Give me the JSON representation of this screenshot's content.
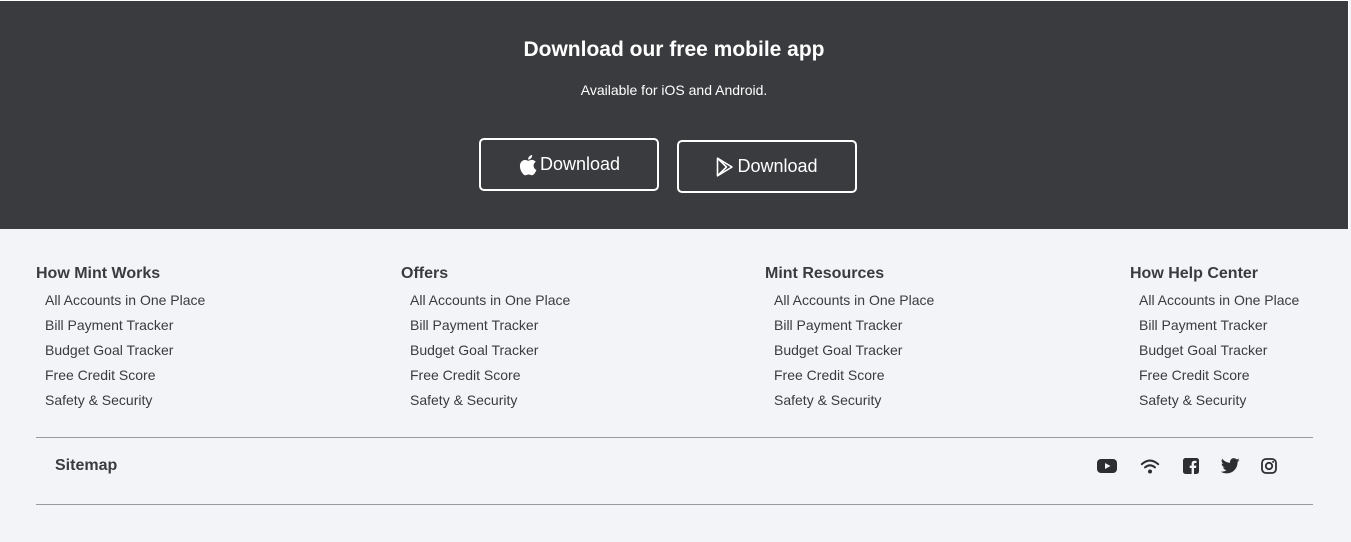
{
  "banner": {
    "title": "Download our free mobile app",
    "subtitle": "Available for iOS and Android.",
    "ios_label": "Download",
    "android_label": "Download"
  },
  "footer": {
    "columns": [
      {
        "title": "How Mint Works",
        "links": [
          "All Accounts in One Place",
          "Bill Payment Tracker",
          "Budget Goal Tracker",
          "Free Credit Score",
          "Safety & Security"
        ]
      },
      {
        "title": "Offers",
        "links": [
          "All Accounts in One Place",
          "Bill Payment Tracker",
          "Budget Goal Tracker",
          "Free Credit Score",
          "Safety & Security"
        ]
      },
      {
        "title": "Mint Resources",
        "links": [
          "All Accounts in One Place",
          "Bill Payment Tracker",
          "Budget Goal Tracker",
          "Free Credit Score",
          "Safety & Security"
        ]
      },
      {
        "title": "How Help Center",
        "links": [
          "All Accounts in One Place",
          "Bill Payment Tracker",
          "Budget Goal Tracker",
          "Free Credit Score",
          "Safety & Security"
        ]
      }
    ],
    "sitemap_label": "Sitemap",
    "social_icons": [
      "youtube-icon",
      "wifi-icon",
      "facebook-icon",
      "twitter-icon",
      "instagram-icon"
    ]
  },
  "colors": {
    "banner_bg": "#3a3b3f",
    "footer_bg": "#f3f4f8",
    "text": "#3a3b3f",
    "divider": "#9a9a9a"
  }
}
